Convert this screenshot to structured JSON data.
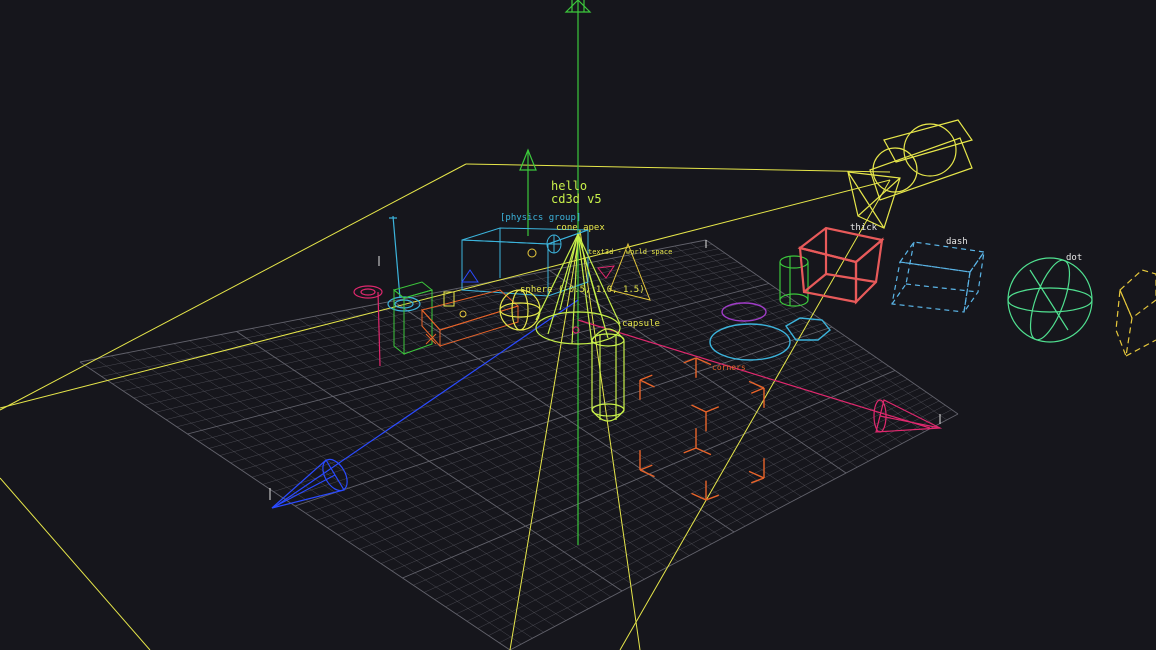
{
  "viewport": {
    "background": "#16161c"
  },
  "overlay": {
    "title_line1": "hello",
    "title_line2": "cd3d v5"
  },
  "labels": {
    "physics_group": "[physics group]",
    "cone_apex": "cone apex",
    "world_space": "text3d - world space",
    "sphere_coords": "sphere (-0.5, 1.0, 1.5)",
    "capsule": "capsule",
    "thick": "thick",
    "dash": "dash",
    "dot": "dot",
    "corners": "corners"
  },
  "colors": {
    "grid": "#6a6a74",
    "grid_major": "#9a9aa4",
    "yellow": "#e6e64a",
    "yellow_green": "#c8f04a",
    "green": "#3cc83c",
    "blue": "#2a4aff",
    "magenta": "#e0286e",
    "cyan": "#3cb4dc",
    "red": "#e85a5a",
    "orange": "#e8642a",
    "purple": "#a03cc8",
    "mint": "#50e090",
    "light_blue": "#5ab4e6",
    "gold": "#e6c83c"
  }
}
